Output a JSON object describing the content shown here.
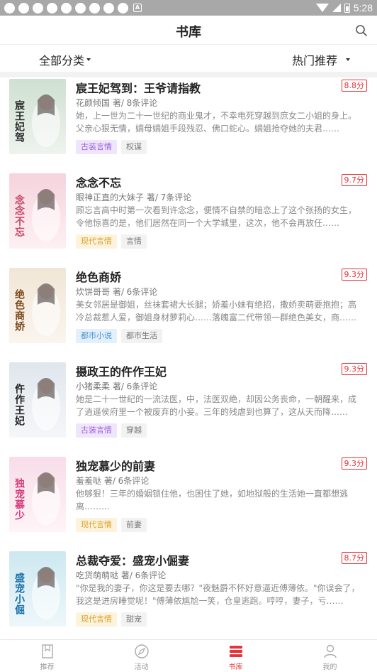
{
  "status_bar": {
    "time": "5:28",
    "notification_count": 9
  },
  "header": {
    "title": "书库",
    "search_icon": "search-icon"
  },
  "filters": {
    "category": "全部分类",
    "sort": "热门推荐"
  },
  "colors": {
    "accent": "#e8333a",
    "tag_guzhuang": "#9a5fe0",
    "tag_xiandai": "#d8a22c",
    "tag_dushi": "#4a90d6"
  },
  "books": [
    {
      "title": "宸王妃驾到：王爷请指教",
      "score": "8.8分",
      "author_line": "花颜倾国 著/ 8条评论",
      "desc": "她，上一世为二十一世纪的商业鬼才，不幸电死穿越到庶女二小姐的身上。父亲心狠无情，嫡母嫡姐手段残忍、佛口蛇心。嫡姐抢夺她的夫君……",
      "tag_main": "古装言情",
      "tag_main_style": "gz",
      "tag_sub": "权谋",
      "cover_text": "宸王妃驾到",
      "cover_bg": [
        "#cfe0d2",
        "#eef3ee"
      ],
      "cover_ink": "#2b2b2b"
    },
    {
      "title": "念念不忘",
      "score": "9.7分",
      "author_line": "眼神正直的大妹子 著/ 7条评论",
      "desc": "顾忘言高中时第一次看到许念念，便情不自禁的暗恋上了这个张扬的女生，令他惊喜的是，他们居然在同一个大学城里，这次，他不会再放任……",
      "tag_main": "现代言情",
      "tag_main_style": "xd",
      "tag_sub": "言情",
      "cover_text": "念念不忘",
      "cover_bg": [
        "#f6d3dc",
        "#fdf0f3"
      ],
      "cover_ink": "#c24a6a"
    },
    {
      "title": "绝色商娇",
      "score": "9.3分",
      "author_line": "炊饼哥哥 著/ 6条评论",
      "desc": "美女邻居是御姐，丝袜套裙大长腿；娇羞小妹有绝招，撒娇卖萌要抱抱；高冷总裁惹人爱，御姐身材萝莉心……落魄富二代带领一群绝色美女，商……",
      "tag_main": "都市小说",
      "tag_main_style": "ds",
      "tag_sub": "都市生活",
      "cover_text": "绝色商娇",
      "cover_bg": [
        "#f1e6d6",
        "#faf5ee"
      ],
      "cover_ink": "#7a4a1e"
    },
    {
      "title": "摄政王的仵作王妃",
      "score": "9.3分",
      "author_line": "小猪柔柔 著/ 6条评论",
      "desc": "她是二十一世纪的一流法医，中，法医双绝，却因公务丧命，一朝醒来，成了逍遥侯府里一个被废弃的小妾。三年的残虐到也算了，这从天而降……",
      "tag_main": "古装言情",
      "tag_main_style": "gz",
      "tag_sub": "穿越",
      "cover_text": "仵作王妃",
      "cover_bg": [
        "#dfe6ec",
        "#f5f7f9"
      ],
      "cover_ink": "#1e1e1e"
    },
    {
      "title": "独宠慕少的前妻",
      "score": "9.3分",
      "author_line": "羞羞哒 著/ 6条评论",
      "desc": "他够狠！三年的婚姻锁住他，也困住了她，如地狱般的生活她一直都想逃离………",
      "tag_main": "现代言情",
      "tag_main_style": "xd",
      "tag_sub": "前妻",
      "cover_text": "独宠慕少的前妻",
      "cover_bg": [
        "#f7dde8",
        "#fff4f8"
      ],
      "cover_ink": "#d43d7c"
    },
    {
      "title": "总裁夺爱：盛宠小倔妻",
      "score": "8.7分",
      "author_line": "吃货萌萌哒 著/ 6条评论",
      "desc": "\"你是我的妻子，你这是要去哪？\"夜魅爵不怀好意逼近傅薄依。\"你误会了，我这是进房睡觉呢！\"傅薄依尴尬一笑，仓皇逃跑。哼哼，妻子，亏……",
      "tag_main": "现代言情",
      "tag_main_style": "xd",
      "tag_sub": "甜宠",
      "cover_text": "盛宠小倔妻",
      "cover_bg": [
        "#cde8f0",
        "#eef7fa"
      ],
      "cover_ink": "#1b6fa8"
    }
  ],
  "nav": [
    {
      "label": "推荐",
      "icon": "bookmark-icon",
      "active": false
    },
    {
      "label": "活动",
      "icon": "compass-icon",
      "active": false
    },
    {
      "label": "书库",
      "icon": "library-icon",
      "active": true
    },
    {
      "label": "我的",
      "icon": "user-icon",
      "active": false
    }
  ]
}
